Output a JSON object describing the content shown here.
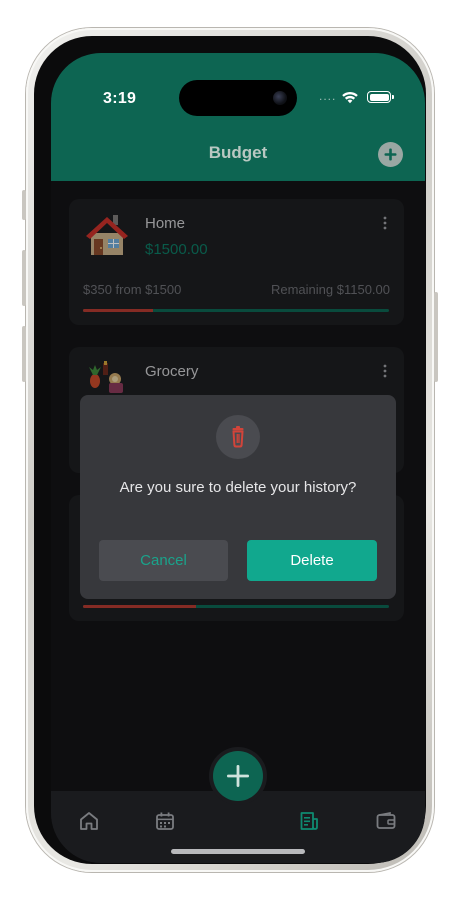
{
  "status_bar": {
    "time": "3:19",
    "signal": "....",
    "wifi_icon": "wifi-icon",
    "battery_icon": "battery-icon"
  },
  "header": {
    "title": "Budget",
    "add_icon": "plus-icon"
  },
  "budgets": [
    {
      "name": "Home",
      "amount": "$1500.00",
      "spent_text": "$350 from $1500",
      "remaining_text": "Remaining $1150.00",
      "progress": 0.23,
      "icon": "house-icon"
    },
    {
      "name": "Grocery",
      "icon": "grocery-icon"
    },
    {
      "name": "",
      "progress": 0.37
    }
  ],
  "dialog": {
    "icon": "trash-icon",
    "message": "Are you sure to delete your history?",
    "cancel_label": "Cancel",
    "delete_label": "Delete"
  },
  "nav": {
    "fab_icon": "plus-icon",
    "items": [
      {
        "icon": "home-icon",
        "active": false
      },
      {
        "icon": "calendar-icon",
        "active": false
      },
      {
        "icon": "receipt-icon",
        "active": true
      },
      {
        "icon": "wallet-icon",
        "active": false
      }
    ]
  },
  "colors": {
    "brand": "#0d6552",
    "accent": "#11a88e",
    "danger": "#b23a30",
    "background": "#131316"
  }
}
